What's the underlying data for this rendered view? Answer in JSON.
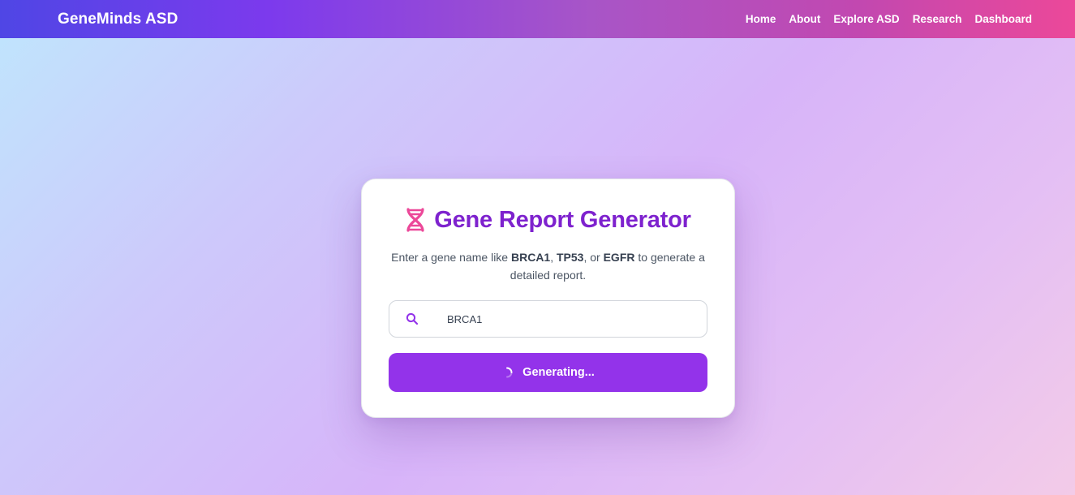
{
  "nav": {
    "brand": "GeneMinds ASD",
    "links": [
      "Home",
      "About",
      "Explore ASD",
      "Research",
      "Dashboard"
    ]
  },
  "card": {
    "title": "Gene Report Generator",
    "subtitle_prefix": "Enter a gene name like ",
    "example_genes": [
      "BRCA1",
      "TP53",
      "EGFR"
    ],
    "sep_1": ", ",
    "sep_2": ", or ",
    "subtitle_suffix": " to generate a detailed report."
  },
  "search": {
    "value": "BRCA1",
    "icon": "search-icon"
  },
  "button": {
    "label": "Generating...",
    "icon": "spinner-icon"
  },
  "colors": {
    "accent": "#9333ea",
    "title": "#7e22ce",
    "dna_icon": "#ec4899",
    "nav_gradient_start": "#4f46e5",
    "nav_gradient_end": "#ec4899"
  }
}
